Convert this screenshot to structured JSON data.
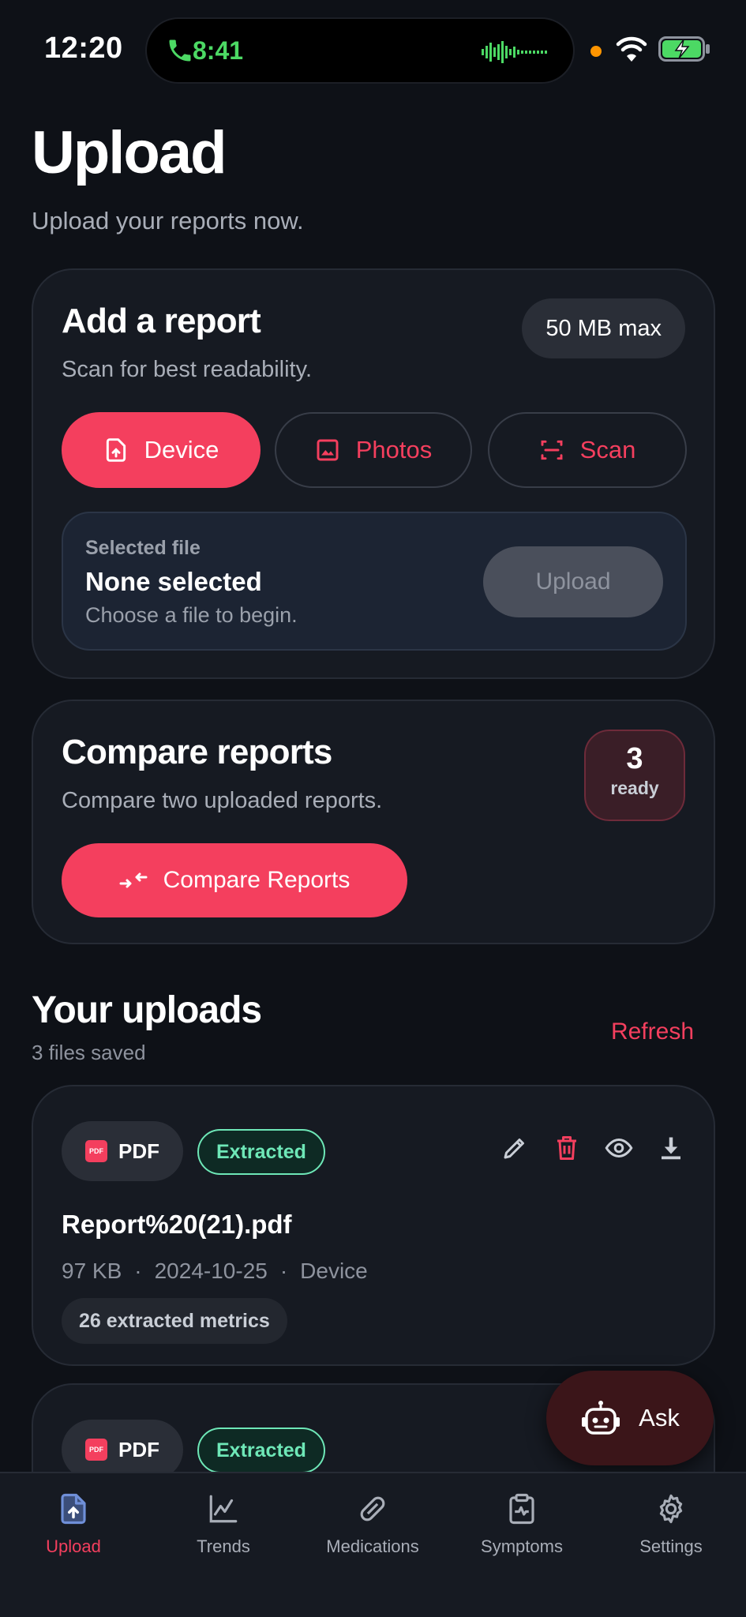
{
  "status_bar": {
    "time": "12:20",
    "call_time": "8:41"
  },
  "header": {
    "title": "Upload",
    "subtitle": "Upload your reports now."
  },
  "add_report": {
    "title": "Add a report",
    "subtitle": "Scan for best readability.",
    "max_size": "50 MB max",
    "sources": [
      {
        "label": "Device",
        "icon": "file-upload-icon"
      },
      {
        "label": "Photos",
        "icon": "image-icon"
      },
      {
        "label": "Scan",
        "icon": "scan-icon"
      }
    ],
    "file": {
      "label": "Selected file",
      "name": "None selected",
      "hint": "Choose a file to begin.",
      "upload_label": "Upload"
    }
  },
  "compare": {
    "title": "Compare reports",
    "subtitle": "Compare two uploaded reports.",
    "ready_count": "3",
    "ready_label": "ready",
    "button_label": "Compare Reports"
  },
  "uploads": {
    "title": "Your uploads",
    "count_text": "3 files saved",
    "refresh_label": "Refresh",
    "items": [
      {
        "type": "PDF",
        "status": "Extracted",
        "name": "Report%20(21).pdf",
        "size": "97 KB",
        "date": "2024-10-25",
        "source": "Device",
        "metrics": "26 extracted metrics"
      },
      {
        "type": "PDF",
        "status": "Extracted"
      }
    ]
  },
  "fab": {
    "label": "Ask"
  },
  "tabs": [
    {
      "label": "Upload",
      "active": true
    },
    {
      "label": "Trends"
    },
    {
      "label": "Medications"
    },
    {
      "label": "Symptoms"
    },
    {
      "label": "Settings"
    }
  ],
  "colors": {
    "accent": "#f43f5e",
    "background": "#0e1117",
    "card": "#161a22",
    "success": "#6ee7b7"
  }
}
